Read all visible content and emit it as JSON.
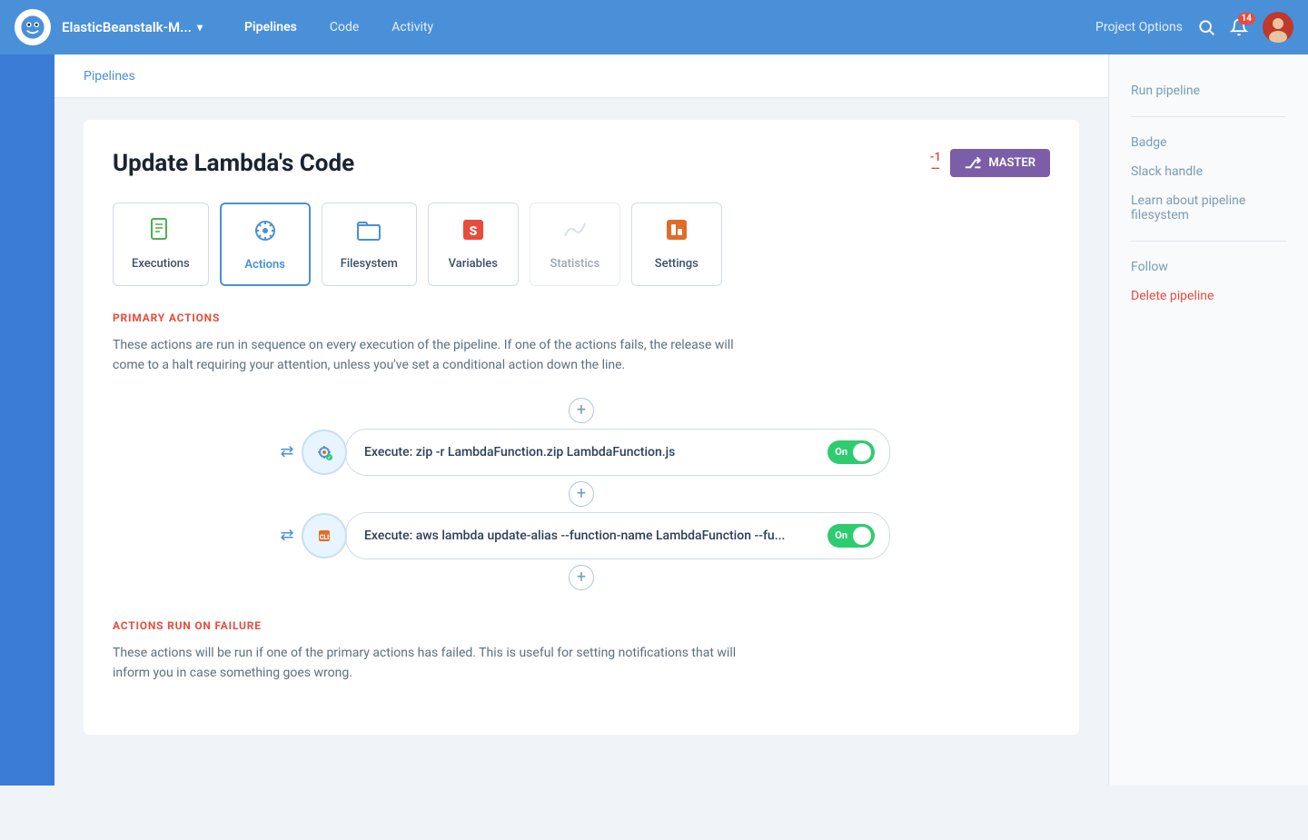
{
  "nav": {
    "project_name": "ElasticBeanstalk-M...",
    "links": [
      "Pipelines",
      "Code",
      "Activity"
    ],
    "active_link": "Pipelines",
    "project_options": "Project Options",
    "notification_count": "14"
  },
  "breadcrumb": {
    "label": "Pipelines"
  },
  "pipeline": {
    "title": "Update Lambda's Code",
    "branch_indicator": "-1",
    "master_label": "MASTER"
  },
  "tabs": [
    {
      "id": "executions",
      "label": "Executions",
      "icon": "📄",
      "active": false,
      "disabled": false
    },
    {
      "id": "actions",
      "label": "Actions",
      "icon": "⚙️",
      "active": true,
      "disabled": false
    },
    {
      "id": "filesystem",
      "label": "Filesystem",
      "icon": "📁",
      "active": false,
      "disabled": false
    },
    {
      "id": "variables",
      "label": "Variables",
      "icon": "🅂",
      "active": false,
      "disabled": false
    },
    {
      "id": "statistics",
      "label": "Statistics",
      "icon": "〰",
      "active": false,
      "disabled": true
    },
    {
      "id": "settings",
      "label": "Settings",
      "icon": "🟧",
      "active": false,
      "disabled": false
    }
  ],
  "primary_actions": {
    "section_label": "PRIMARY ACTIONS",
    "description": "These actions are run in sequence on every execution of the pipeline. If one of the actions fails, the release will come to a halt requiring your attention, unless you've set a conditional action down the line.",
    "items": [
      {
        "text": "Execute: zip -r LambdaFunction.zip LambdaFunction.js",
        "toggle": "On"
      },
      {
        "text": "Execute: aws lambda update-alias --function-name LambdaFunction --fu...",
        "toggle": "On"
      }
    ]
  },
  "failure_actions": {
    "section_label": "ACTIONS RUN ON FAILURE",
    "description": "These actions will be run if one of the primary actions has failed. This is useful for setting notifications that will inform you in case something goes wrong."
  },
  "right_sidebar": {
    "links": [
      {
        "id": "run-pipeline",
        "label": "Run pipeline",
        "type": "normal"
      },
      {
        "id": "badge",
        "label": "Badge",
        "type": "normal"
      },
      {
        "id": "slack-handle",
        "label": "Slack handle",
        "type": "normal"
      },
      {
        "id": "learn-pipeline-filesystem",
        "label": "Learn about pipeline filesystem",
        "type": "normal"
      },
      {
        "id": "follow",
        "label": "Follow",
        "type": "normal"
      },
      {
        "id": "delete-pipeline",
        "label": "Delete pipeline",
        "type": "danger"
      }
    ]
  }
}
